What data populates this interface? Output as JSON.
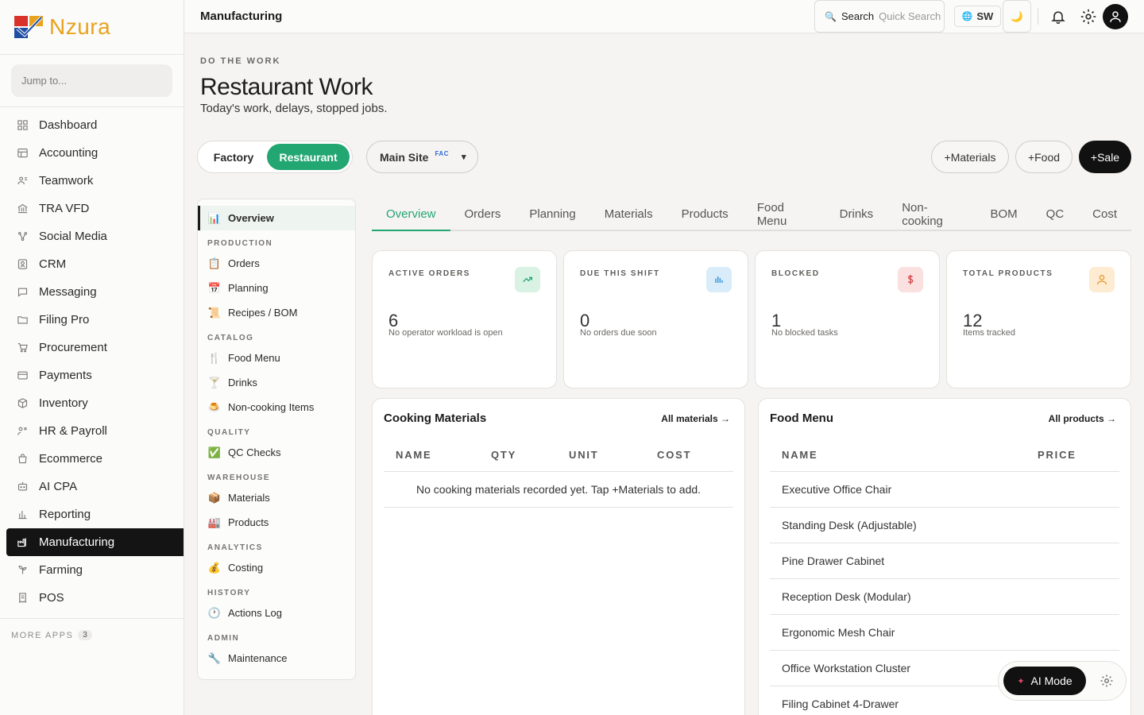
{
  "app": {
    "brand": "Nzura",
    "page_title": "Manufacturing"
  },
  "topbar": {
    "search_label": "Search",
    "search_placeholder": "Quick Search",
    "language": "SW",
    "theme_icon": "moon-icon"
  },
  "sidebar": {
    "jump_placeholder": "Jump to...",
    "items": [
      {
        "label": "Dashboard",
        "icon": "grid-icon"
      },
      {
        "label": "Accounting",
        "icon": "ledger-icon"
      },
      {
        "label": "Teamwork",
        "icon": "team-icon"
      },
      {
        "label": "TRA VFD",
        "icon": "bank-icon"
      },
      {
        "label": "Social Media",
        "icon": "share-icon"
      },
      {
        "label": "CRM",
        "icon": "contact-icon"
      },
      {
        "label": "Messaging",
        "icon": "chat-icon"
      },
      {
        "label": "Filing Pro",
        "icon": "folder-icon"
      },
      {
        "label": "Procurement",
        "icon": "cart-icon"
      },
      {
        "label": "Payments",
        "icon": "card-icon"
      },
      {
        "label": "Inventory",
        "icon": "box-icon"
      },
      {
        "label": "HR & Payroll",
        "icon": "people-icon"
      },
      {
        "label": "Ecommerce",
        "icon": "bag-icon"
      },
      {
        "label": "AI CPA",
        "icon": "robot-icon"
      },
      {
        "label": "Reporting",
        "icon": "bar-chart-icon"
      },
      {
        "label": "Manufacturing",
        "icon": "factory-icon",
        "active": true
      },
      {
        "label": "Farming",
        "icon": "sprout-icon"
      },
      {
        "label": "POS",
        "icon": "receipt-icon"
      }
    ],
    "more_apps_label": "MORE APPS",
    "more_apps_count": "3"
  },
  "header": {
    "eyebrow": "DO THE WORK",
    "title": "Restaurant Work",
    "subtitle": "Today's work, delays, stopped jobs."
  },
  "mode_toggle": {
    "options": [
      "Factory",
      "Restaurant"
    ],
    "selected": "Restaurant"
  },
  "site_select": {
    "label": "Main Site",
    "badge": "FAC",
    "caret": "▾"
  },
  "actions": {
    "materials": "+Materials",
    "food": "+Food",
    "sale": "+Sale"
  },
  "subnav": {
    "overview": "Overview",
    "sections": [
      {
        "title": "PRODUCTION",
        "items": [
          {
            "emoji": "📋",
            "label": "Orders"
          },
          {
            "emoji": "📅",
            "label": "Planning"
          },
          {
            "emoji": "📜",
            "label": "Recipes / BOM"
          }
        ]
      },
      {
        "title": "CATALOG",
        "items": [
          {
            "emoji": "🍴",
            "label": "Food Menu"
          },
          {
            "emoji": "🍸",
            "label": "Drinks"
          },
          {
            "emoji": "🍮",
            "label": "Non-cooking Items"
          }
        ]
      },
      {
        "title": "QUALITY",
        "items": [
          {
            "emoji": "✅",
            "label": "QC Checks"
          }
        ]
      },
      {
        "title": "WAREHOUSE",
        "items": [
          {
            "emoji": "📦",
            "label": "Materials"
          },
          {
            "emoji": "🏭",
            "label": "Products"
          }
        ]
      },
      {
        "title": "ANALYTICS",
        "items": [
          {
            "emoji": "💰",
            "label": "Costing"
          }
        ]
      },
      {
        "title": "HISTORY",
        "items": [
          {
            "emoji": "🕐",
            "label": "Actions Log"
          }
        ]
      },
      {
        "title": "ADMIN",
        "items": [
          {
            "emoji": "🔧",
            "label": "Maintenance"
          }
        ]
      }
    ]
  },
  "tabs": [
    "Overview",
    "Orders",
    "Planning",
    "Materials",
    "Products",
    "Food Menu",
    "Drinks",
    "Non-cooking",
    "BOM",
    "QC",
    "Cost"
  ],
  "active_tab": "Overview",
  "stats": [
    {
      "label": "ACTIVE ORDERS",
      "value": "6",
      "note": "No operator workload is open",
      "icon": "trend-up-icon",
      "color": "#22a672",
      "bg": "#d9f2e4"
    },
    {
      "label": "DUE THIS SHIFT",
      "value": "0",
      "note": "No orders due soon",
      "icon": "bar-chart-icon",
      "color": "#2b8fd6",
      "bg": "#d8ecfa"
    },
    {
      "label": "BLOCKED",
      "value": "1",
      "note": "No blocked tasks",
      "icon": "dollar-icon",
      "color": "#d94848",
      "bg": "#fbe0e0"
    },
    {
      "label": "TOTAL PRODUCTS",
      "value": "12",
      "note": "Items tracked",
      "icon": "user-icon",
      "color": "#e59a2a",
      "bg": "#fdebd2"
    }
  ],
  "materials_panel": {
    "title": "Cooking Materials",
    "link": "All materials →",
    "columns": [
      "NAME",
      "QTY",
      "UNIT",
      "COST"
    ],
    "empty": "No cooking materials recorded yet. Tap +Materials to add."
  },
  "food_panel": {
    "title": "Food Menu",
    "link": "All products →",
    "columns": [
      "NAME",
      "PRICE"
    ],
    "rows": [
      "Executive Office Chair",
      "Standing Desk (Adjustable)",
      "Pine Drawer Cabinet",
      "Reception Desk (Modular)",
      "Ergonomic Mesh Chair",
      "Office Workstation Cluster",
      "Filing Cabinet 4-Drawer"
    ]
  },
  "ai": {
    "label": "AI Mode"
  }
}
